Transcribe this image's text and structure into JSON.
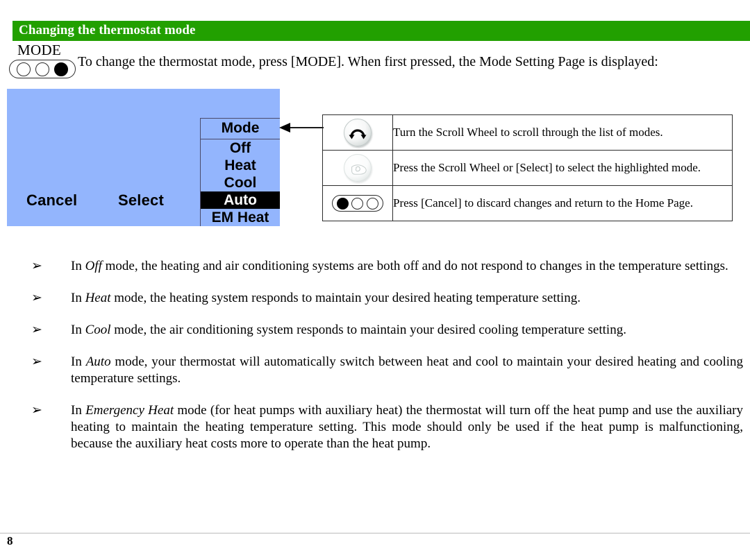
{
  "section": {
    "header_title": "Changing the thermostat mode",
    "header_color": "#22a000"
  },
  "mode_key": {
    "label": "MODE",
    "dots": [
      "empty",
      "empty",
      "filled"
    ]
  },
  "intro": {
    "text": "To change the thermostat mode, press [MODE].  When first pressed, the Mode Setting Page is displayed:"
  },
  "lcd": {
    "background_color": "#93b5fd",
    "softkey_left": "Cancel",
    "softkey_center": "Select",
    "mode_list": {
      "title": "Mode",
      "items": [
        {
          "label": "Off",
          "selected": false
        },
        {
          "label": "Heat",
          "selected": false
        },
        {
          "label": "Cool",
          "selected": false
        },
        {
          "label": "Auto",
          "selected": true
        },
        {
          "label": "EM Heat",
          "selected": false
        }
      ]
    }
  },
  "instruction_table": {
    "rows": [
      {
        "icon": "scroll-wheel-rotate-icon",
        "text": "Turn the Scroll Wheel to scroll through the list of modes."
      },
      {
        "icon": "scroll-wheel-press-hand-icon",
        "text": "Press the Scroll Wheel or [Select] to select the highlighted mode."
      },
      {
        "icon": "cancel-key-icon",
        "text": "Press [Cancel] to discard changes and return to the Home Page."
      }
    ],
    "cancel_key_dots": [
      "filled",
      "empty",
      "empty"
    ]
  },
  "mode_descriptions": {
    "bullet_glyph": "➢",
    "items": [
      {
        "lead": "In ",
        "term": "Off",
        "rest": " mode, the heating and air conditioning systems are both off and do not respond to changes in the temperature settings."
      },
      {
        "lead": "In ",
        "term": "Heat",
        "rest": " mode, the heating system responds to maintain your desired heating temperature setting."
      },
      {
        "lead": "In ",
        "term": "Cool",
        "rest": " mode, the air conditioning system responds to maintain your desired cooling temperature setting."
      },
      {
        "lead": "In ",
        "term": "Auto",
        "rest": " mode, your thermostat will automatically switch between heat and cool to maintain your desired heating and cooling temperature settings."
      },
      {
        "lead": "In ",
        "term": "Emergency Heat",
        "rest": " mode (for heat pumps with auxiliary heat) the thermostat will turn off the heat pump and use the auxiliary heating to maintain the heating temperature setting.  This mode should only be used if the heat pump is malfunctioning, because the auxiliary heat costs more to operate than the heat pump."
      }
    ]
  },
  "footer": {
    "page_number": "8"
  }
}
